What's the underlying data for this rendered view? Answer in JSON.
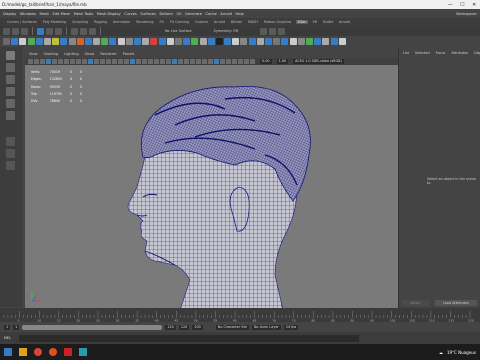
{
  "window": {
    "title": "D:/model/go_tall/brief/hair_1/maya/file.mb",
    "controls": [
      "—",
      "☐",
      "✕"
    ]
  },
  "menu": [
    "Display",
    "Windows",
    "Mesh",
    "Edit Mesh",
    "Mesh Tools",
    "Mesh Display",
    "Curves",
    "Surfaces",
    "Deform",
    "UV",
    "Generate",
    "Cache",
    "Arnold",
    "Help"
  ],
  "workspace": "Workspace:",
  "shelf_tabs": [
    "Curves / Surfaces",
    "Poly Modeling",
    "Sculpting",
    "Rigging",
    "Animation",
    "Rendering",
    "FX",
    "FX Caching",
    "Custom",
    "Arnold",
    "Bifrost",
    "MASH",
    "Motion Graphics",
    "XGen",
    "VR",
    "Bullet",
    "Arnold"
  ],
  "active_shelf_tab_index": 13,
  "status": {
    "symmetry": "Symmetry: Off",
    "live": "No Live Surface"
  },
  "panel_menu": [
    "View",
    "Shading",
    "Lighting",
    "Show",
    "Renderer",
    "Panels"
  ],
  "panel_tools": {
    "exposure": "0.00",
    "gamma": "1.00",
    "color_space": "ACES 1.0 SDR-video (sRGB)"
  },
  "hud": {
    "rows": [
      {
        "label": "Verts:",
        "a": "70519",
        "b": "0",
        "c": "0"
      },
      {
        "label": "Edges:",
        "a": "132855",
        "b": "0",
        "c": "0"
      },
      {
        "label": "Faces:",
        "a": "59339",
        "b": "0",
        "c": "0"
      },
      {
        "label": "Tris:",
        "a": "119792",
        "b": "0",
        "c": "0"
      },
      {
        "label": "UVs:",
        "a": "78840",
        "b": "0",
        "c": "0"
      }
    ]
  },
  "right_panel": {
    "tabs": [
      "List",
      "Selected",
      "Focus",
      "Attributes",
      "Display"
    ],
    "message": "Select an object in the scene to",
    "buttons": [
      "Select",
      "Load Attributes"
    ]
  },
  "time_ticks": [
    "5",
    "10",
    "15",
    "20",
    "25",
    "30",
    "35",
    "40",
    "45",
    "50",
    "55",
    "60",
    "65",
    "70",
    "75",
    "80",
    "85",
    "90",
    "95",
    "100",
    "105",
    "110",
    "115",
    "120"
  ],
  "range": {
    "start": "1",
    "inner_start": "1",
    "inner_end": "120",
    "end": "120",
    "max": "200"
  },
  "char_set": "No Character Set",
  "anim_layer": "No Anim Layer",
  "fps": "24 fps",
  "cmd_label": "MEL",
  "tray": {
    "weather": "19°C  Nuageux"
  },
  "colors": {
    "mesh": "#1a1a8c",
    "skin": "#c8c8d0",
    "active_tab": "#5d5d5d"
  }
}
